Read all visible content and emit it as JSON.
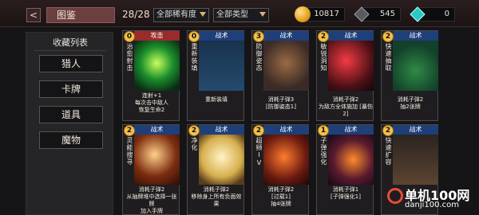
{
  "header": {
    "back_icon": "back-arrow-icon",
    "title": "图鉴",
    "count": "28/28",
    "filter_rarity": "全部稀有度",
    "filter_type": "全部类型",
    "gold": "10817",
    "dark_gem": "545",
    "teal_gem": "0",
    "colors": {
      "gold": "#f2b33a",
      "dark_gem": "#5a5a63",
      "teal_gem": "#2bc7c3"
    }
  },
  "sidebar": {
    "title": "收藏列表",
    "items": [
      {
        "label": "猎人"
      },
      {
        "label": "卡牌"
      },
      {
        "label": "道具"
      },
      {
        "label": "魔物"
      }
    ]
  },
  "cards": [
    {
      "cost": "0",
      "type": "攻击",
      "name": "治愈射击",
      "desc": "连射+1\n每次击中敌人\n恢复生命2",
      "header_color": "#9a2b2b"
    },
    {
      "cost": "0",
      "type": "战术",
      "name": "重新装填",
      "desc": "重新装填",
      "header_color": "#1f3f7a"
    },
    {
      "cost": "3",
      "type": "战术",
      "name": "防御姿态",
      "desc": "消耗子弹3\n[防御姿态1]",
      "header_color": "#1f3f7a"
    },
    {
      "cost": "2",
      "type": "战术",
      "name": "敏锐洞知",
      "desc": "消耗子弹2\n为敌方全体施加 [暴伤2]",
      "header_color": "#1f3f7a"
    },
    {
      "cost": "2",
      "type": "战术",
      "name": "快速抽取",
      "desc": "消耗子弹2\n抽2张牌",
      "header_color": "#1f3f7a"
    },
    {
      "cost": "2",
      "type": "战术",
      "name": "灵能搜寻",
      "desc": "消耗子弹2\n从抽牌堆中选择一张牌\n加入手牌",
      "header_color": "#1f3f7a"
    },
    {
      "cost": "2",
      "type": "战术",
      "name": "净化",
      "desc": "消耗子弹2\n移除身上所有负面效果",
      "header_color": "#1f3f7a"
    },
    {
      "cost": "2",
      "type": "战术",
      "name": "超频IV",
      "desc": "消耗子弹2\n[过载1]\n抽4张牌",
      "header_color": "#1f3f7a"
    },
    {
      "cost": "1",
      "type": "战术",
      "name": "子弹强化",
      "desc": "消耗子弹1\n[子弹强化1]",
      "header_color": "#1f3f7a"
    },
    {
      "cost": "2",
      "type": "战术",
      "name": "快速扩容",
      "desc": "",
      "header_color": "#1f3f7a"
    }
  ],
  "watermark": {
    "line1": "单机100网",
    "line2": "danji100.com"
  }
}
